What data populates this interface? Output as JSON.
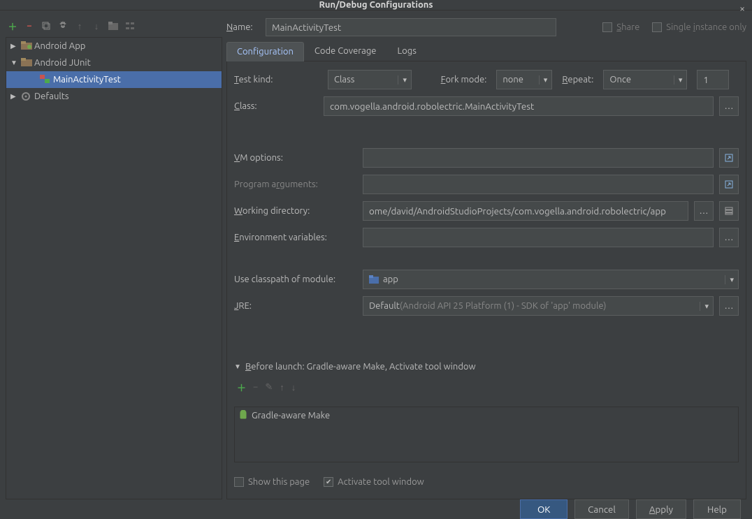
{
  "window": {
    "title": "Run/Debug Configurations"
  },
  "tree": {
    "items": [
      {
        "label": "Android App"
      },
      {
        "label": "Android JUnit"
      },
      {
        "label": "MainActivityTest"
      },
      {
        "label": "Defaults"
      }
    ]
  },
  "nameRow": {
    "label": "Name:",
    "value": "MainActivityTest",
    "shareLabel": "Share",
    "singleInstanceLabel": "Single instance only"
  },
  "tabs": {
    "configuration": "Configuration",
    "codeCoverage": "Code Coverage",
    "logs": "Logs"
  },
  "config": {
    "testKindLabel": "Test kind:",
    "testKindValue": "Class",
    "forkModeLabel": "Fork mode:",
    "forkModeValue": "none",
    "repeatLabel": "Repeat:",
    "repeatValue": "Once",
    "repeatCount": "1",
    "classLabel": "Class:",
    "classValue": "com.vogella.android.robolectric.MainActivityTest",
    "vmLabel": "VM options:",
    "argsLabel": "Program arguments:",
    "workdirLabel": "Working directory:",
    "workdirValue": "ome/david/AndroidStudioProjects/com.vogella.android.robolectric/app",
    "envLabel": "Environment variables:",
    "classpathLabel": "Use classpath of module:",
    "classpathValue": "app",
    "jreLabel": "JRE:",
    "jrePrefix": "Default ",
    "jreMuted": "(Android API 25 Platform (1) - SDK of 'app' module)"
  },
  "beforeLaunch": {
    "header": "Before launch: Gradle-aware Make, Activate tool window",
    "item": "Gradle-aware Make",
    "showThis": "Show this page",
    "activate": "Activate tool window"
  },
  "footer": {
    "ok": "OK",
    "cancel": "Cancel",
    "apply": "Apply",
    "help": "Help"
  }
}
